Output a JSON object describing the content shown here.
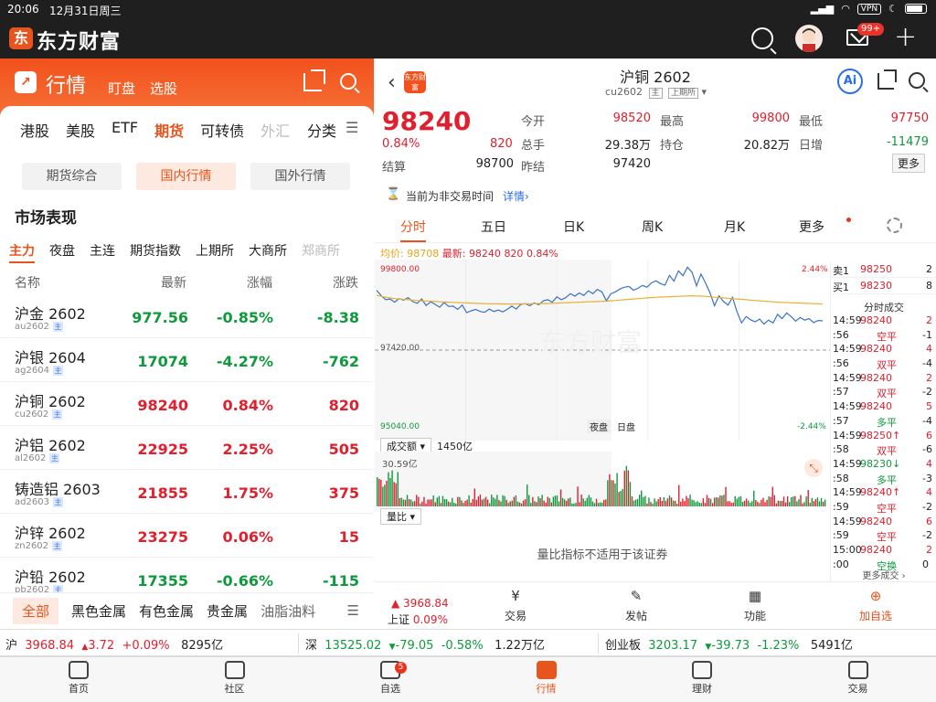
{
  "status": {
    "time": "20:06",
    "date": "12月31日周三",
    "vpn": "VPN"
  },
  "app": {
    "name": "东方财富",
    "logo_char": "东",
    "mail_badge": "99+"
  },
  "left": {
    "header": {
      "title": "行情",
      "links": [
        "盯盘",
        "选股"
      ]
    },
    "category_tabs": [
      {
        "label": "港股",
        "active": false
      },
      {
        "label": "美股",
        "active": false
      },
      {
        "label": "ETF",
        "active": false
      },
      {
        "label": "期货",
        "active": true
      },
      {
        "label": "可转债",
        "active": false
      },
      {
        "label": "外汇",
        "active": false
      }
    ],
    "category_more": "分类",
    "sub_tabs": [
      {
        "label": "期货综合",
        "active": false
      },
      {
        "label": "国内行情",
        "active": true
      },
      {
        "label": "国外行情",
        "active": false
      }
    ],
    "section_title": "市场表现",
    "market_tabs": [
      {
        "label": "主力",
        "active": true
      },
      {
        "label": "夜盘",
        "active": false
      },
      {
        "label": "主连",
        "active": false
      },
      {
        "label": "期货指数",
        "active": false
      },
      {
        "label": "上期所",
        "active": false
      },
      {
        "label": "大商所",
        "active": false
      },
      {
        "label": "郑商所",
        "active": false
      }
    ],
    "columns": [
      "名称",
      "最新",
      "涨幅",
      "涨跌"
    ],
    "rows": [
      {
        "name": "沪金 2602",
        "code": "au2602",
        "tag": "主",
        "last": "977.56",
        "pct": "-0.85%",
        "chg": "-8.38",
        "dir": "down"
      },
      {
        "name": "沪银 2604",
        "code": "ag2604",
        "tag": "主",
        "last": "17074",
        "pct": "-4.27%",
        "chg": "-762",
        "dir": "down"
      },
      {
        "name": "沪铜 2602",
        "code": "cu2602",
        "tag": "主",
        "last": "98240",
        "pct": "0.84%",
        "chg": "820",
        "dir": "up"
      },
      {
        "name": "沪铝 2602",
        "code": "al2602",
        "tag": "主",
        "last": "22925",
        "pct": "2.25%",
        "chg": "505",
        "dir": "up"
      },
      {
        "name": "铸造铝 2603",
        "code": "ad2603",
        "tag": "主",
        "last": "21855",
        "pct": "1.75%",
        "chg": "375",
        "dir": "up"
      },
      {
        "name": "沪锌 2602",
        "code": "zn2602",
        "tag": "主",
        "last": "23275",
        "pct": "0.06%",
        "chg": "15",
        "dir": "up"
      },
      {
        "name": "沪铅 2602",
        "code": "pb2602",
        "tag": "主",
        "last": "17355",
        "pct": "-0.66%",
        "chg": "-115",
        "dir": "down"
      }
    ],
    "bottom_tabs": [
      {
        "label": "全部",
        "active": true
      },
      {
        "label": "黑色金属",
        "active": false
      },
      {
        "label": "有色金属",
        "active": false
      },
      {
        "label": "贵金属",
        "active": false
      },
      {
        "label": "油脂油料",
        "active": false
      }
    ]
  },
  "right": {
    "title": "沪铜 2602",
    "code": "cu2602",
    "tags": [
      "主",
      "上期所"
    ],
    "logo_text": "东方财富",
    "ai_label": "Ai",
    "price": "98240",
    "pct": "0.84%",
    "chg": "820",
    "stats": {
      "jk_label": "今开",
      "jk": "98520",
      "zg_label": "最高",
      "zg": "99800",
      "zd_label": "最低",
      "zd": "97750",
      "zs_label": "总手",
      "zs": "29.38万",
      "cc_label": "持仓",
      "cc": "20.82万",
      "rz_label": "日增",
      "rz": "-11479",
      "js_label": "结算",
      "js": "98700",
      "zj_label": "昨结",
      "zj": "97420",
      "more": "更多"
    },
    "notice": {
      "text": "当前为非交易时间",
      "link": "详情"
    },
    "chart_tabs": [
      {
        "label": "分时",
        "active": true
      },
      {
        "label": "五日",
        "active": false
      },
      {
        "label": "日K",
        "active": false
      },
      {
        "label": "周K",
        "active": false
      },
      {
        "label": "月K",
        "active": false
      },
      {
        "label": "更多",
        "active": false
      }
    ],
    "avg_line": {
      "avg_label": "均价:",
      "avg": "98708",
      "last_label": "最新:",
      "last": "98240",
      "chg": "820",
      "pct": "0.84%"
    },
    "volume_indicator": {
      "name": "成交额",
      "value": "1450亿"
    },
    "ratio_indicator": {
      "name": "量比",
      "message": "量比指标不适用于该证券"
    },
    "order_book": [
      {
        "side": "卖1",
        "price": "98250",
        "qty": "2"
      },
      {
        "side": "买1",
        "price": "98230",
        "qty": "8"
      }
    ],
    "tape_title": "分时成交",
    "tape": [
      {
        "time": "14:59",
        "price": "98240",
        "qty": "2",
        "dir": "up"
      },
      {
        "time": ":56",
        "type": "空平",
        "qty": "-1",
        "dir": "red"
      },
      {
        "time": "14:59",
        "price": "98240",
        "qty": "4",
        "dir": "up"
      },
      {
        "time": ":56",
        "type": "双平",
        "qty": "-4",
        "dir": "red"
      },
      {
        "time": "14:59",
        "price": "98240",
        "qty": "2",
        "dir": "up"
      },
      {
        "time": ":57",
        "type": "双平",
        "qty": "-2",
        "dir": "red"
      },
      {
        "time": "14:59",
        "price": "98240",
        "qty": "5",
        "dir": "up"
      },
      {
        "time": ":57",
        "type": "多平",
        "qty": "-4",
        "dir": "green"
      },
      {
        "time": "14:59",
        "price": "98250↑",
        "qty": "6",
        "dir": "up"
      },
      {
        "time": ":58",
        "type": "双平",
        "qty": "-6",
        "dir": "red"
      },
      {
        "time": "14:59",
        "price": "98230↓",
        "qty": "4",
        "dir": "down"
      },
      {
        "time": ":58",
        "type": "多平",
        "qty": "-3",
        "dir": "green"
      },
      {
        "time": "14:59",
        "price": "98240↑",
        "qty": "4",
        "dir": "up"
      },
      {
        "time": ":59",
        "type": "空平",
        "qty": "-2",
        "dir": "red"
      },
      {
        "time": "14:59",
        "price": "98240",
        "qty": "6",
        "dir": "up"
      },
      {
        "time": ":59",
        "type": "空平",
        "qty": "-2",
        "dir": "red"
      },
      {
        "time": "15:00",
        "price": "98240",
        "qty": "2",
        "dir": "up"
      },
      {
        "time": ":00",
        "type": "空换",
        "qty": "0",
        "dir": "green"
      }
    ],
    "tape_more": "更多成交",
    "toolbar": {
      "index_value": "3968.84",
      "index_name": "上证",
      "index_pct": "0.09%",
      "buttons": [
        "交易",
        "发帖",
        "功能",
        "加自选"
      ]
    }
  },
  "chart_data": {
    "type": "line",
    "y_top_label": "99800.00",
    "y_mid_label": "97420.00",
    "y_bottom_label": "95040.00",
    "pct_top_label": "2.44%",
    "pct_bottom_label": "-2.44%",
    "session_labels": [
      "夜盘",
      "日盘"
    ],
    "ylim": [
      95040,
      99800
    ],
    "prev_settle": 97420,
    "series": [
      {
        "values": [
          99090,
          98950,
          98830,
          98850,
          98760,
          98860,
          98820,
          98890,
          98780,
          98730,
          98850,
          98670,
          98770,
          98700,
          98620,
          98750,
          98640,
          98650,
          98560,
          98680,
          98470,
          98520,
          98560,
          98500,
          98480,
          98570,
          98500,
          98540,
          98490,
          98560,
          98650,
          98570,
          98700,
          98720,
          98660,
          98740,
          98690,
          98800,
          98830,
          98760,
          98910,
          98830,
          98890,
          99000,
          98930,
          99020,
          98950,
          99080,
          99000,
          99120,
          99050,
          98800,
          99000,
          99050,
          99130,
          99180,
          99200,
          99100,
          99150,
          99230,
          99180,
          99300,
          99360,
          99280,
          99240,
          99510,
          99350,
          99640,
          99500,
          99740,
          99600,
          99220,
          99550,
          99300,
          99020,
          98660,
          98940,
          98780,
          98680,
          98900,
          98490,
          98180,
          98360,
          98270,
          98210,
          98290,
          98150,
          98260,
          98180,
          98420,
          98300,
          98460,
          98360,
          98230,
          98330,
          98260,
          98300,
          98190,
          98250,
          98240
        ]
      },
      {
        "values": [
          98950,
          98930,
          98900,
          98880,
          98860,
          98850,
          98840,
          98830,
          98820,
          98810,
          98800,
          98795,
          98790,
          98780,
          98770,
          98765,
          98760,
          98755,
          98750,
          98745,
          98740,
          98735,
          98730,
          98725,
          98720,
          98718,
          98716,
          98714,
          98712,
          98710,
          98710,
          98712,
          98714,
          98716,
          98718,
          98720,
          98722,
          98724,
          98726,
          98730,
          98735,
          98740,
          98745,
          98750,
          98755,
          98760,
          98765,
          98770,
          98775,
          98780,
          98785,
          98790,
          98800,
          98810,
          98820,
          98830,
          98840,
          98850,
          98860,
          98870,
          98880,
          98890,
          98900,
          98905,
          98910,
          98915,
          98920,
          98925,
          98930,
          98935,
          98940,
          98935,
          98930,
          98925,
          98915,
          98900,
          98890,
          98880,
          98870,
          98860,
          98850,
          98840,
          98830,
          98820,
          98810,
          98800,
          98790,
          98780,
          98770,
          98760,
          98755,
          98750,
          98745,
          98740,
          98735,
          98730,
          98725,
          98720,
          98715,
          98708
        ]
      }
    ]
  },
  "index_strip": [
    {
      "name": "沪",
      "value": "3968.84",
      "chg": "3.72",
      "pct": "+0.09%",
      "amount": "8295亿",
      "dir": "up"
    },
    {
      "name": "深",
      "value": "13525.02",
      "chg": "-79.05",
      "pct": "-0.58%",
      "amount": "1.22万亿",
      "dir": "down"
    },
    {
      "name": "创业板",
      "value": "3203.17",
      "chg": "-39.73",
      "pct": "-1.23%",
      "amount": "5491亿",
      "dir": "down"
    }
  ],
  "tabbar": [
    {
      "label": "首页",
      "active": false
    },
    {
      "label": "社区",
      "active": false
    },
    {
      "label": "自选",
      "active": false,
      "badge": "5"
    },
    {
      "label": "行情",
      "active": true
    },
    {
      "label": "理财",
      "active": false
    },
    {
      "label": "交易",
      "active": false
    }
  ]
}
